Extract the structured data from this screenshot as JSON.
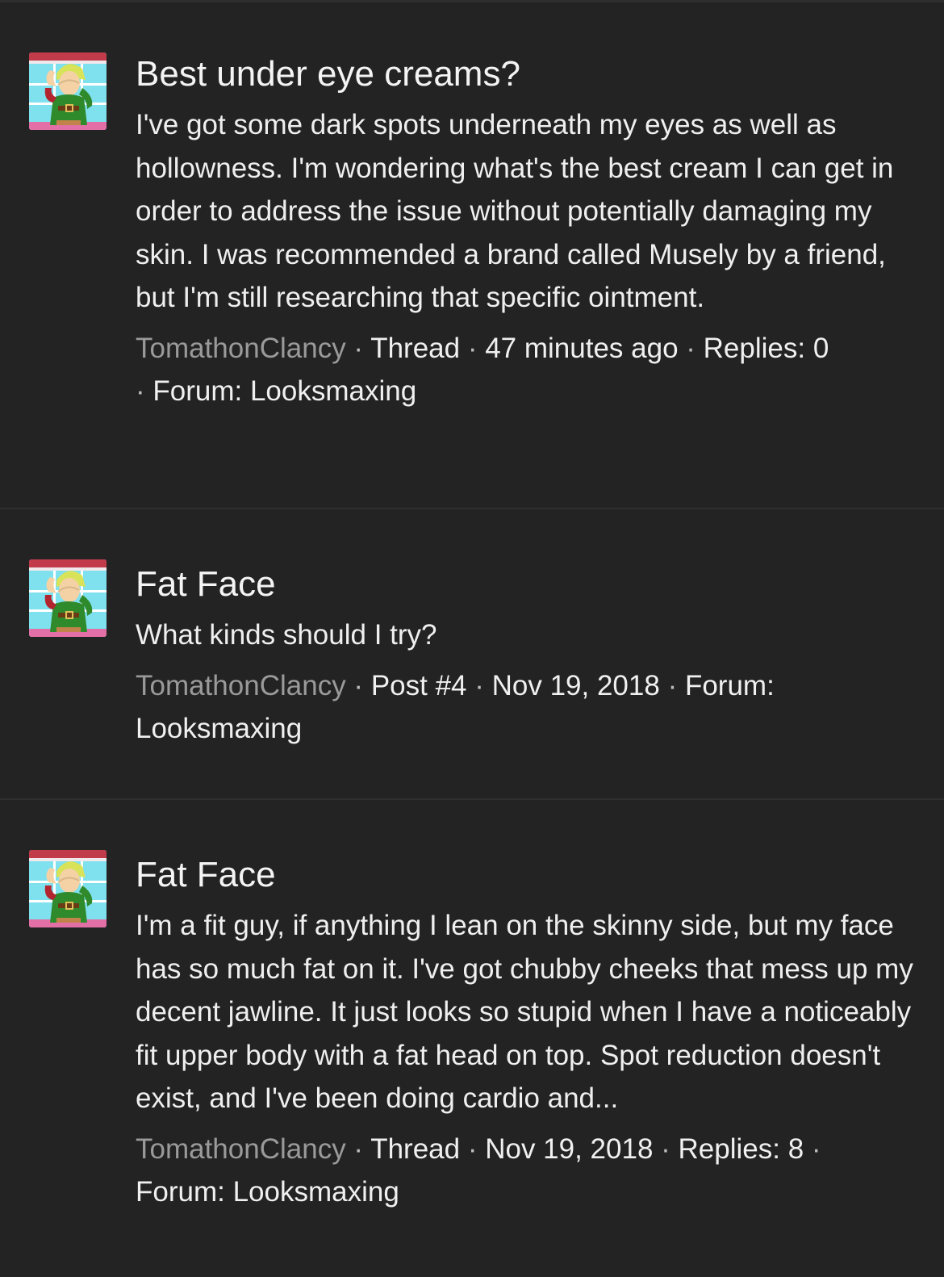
{
  "results": [
    {
      "title": "Best under eye creams?",
      "snippet": "I've got some dark spots underneath my eyes as well as hollowness. I'm wondering what's the best cream I can get in order to address the issue without potentially damaging my skin. I was recommended a brand called Musely by a friend, but I'm still researching that specific ointment.",
      "author": "TomathonClancy",
      "separator": " · ",
      "type": "Thread",
      "time": "47 minutes ago",
      "replies": "Replies: 0",
      "forum": "Forum: Looksmaxing"
    },
    {
      "title": "Fat Face",
      "snippet": "What kinds should I try?",
      "author": "TomathonClancy",
      "separator": " · ",
      "type": "Post #4",
      "time": "Nov 19, 2018",
      "forum": "Forum: Looksmaxing"
    },
    {
      "title": "Fat Face",
      "snippet": "I'm a fit guy, if anything I lean on the skinny side, but my face has so much fat on it. I've got chubby cheeks that mess up my decent jawline. It just looks so stupid when I have a noticeably fit upper body with a fat head on top. Spot reduction doesn't exist, and I've been doing cardio and...",
      "author": "TomathonClancy",
      "separator": " · ",
      "type": "Thread",
      "time": "Nov 19, 2018",
      "replies": "Replies: 8",
      "forum": "Forum: Looksmaxing"
    }
  ],
  "colors": {
    "background": "#232323",
    "divider": "#2f2f2f",
    "text": "#f2f2f2",
    "author": "#9a9a9a"
  },
  "icons": {
    "avatar": "avatar-green-tunic-elf-icon"
  }
}
